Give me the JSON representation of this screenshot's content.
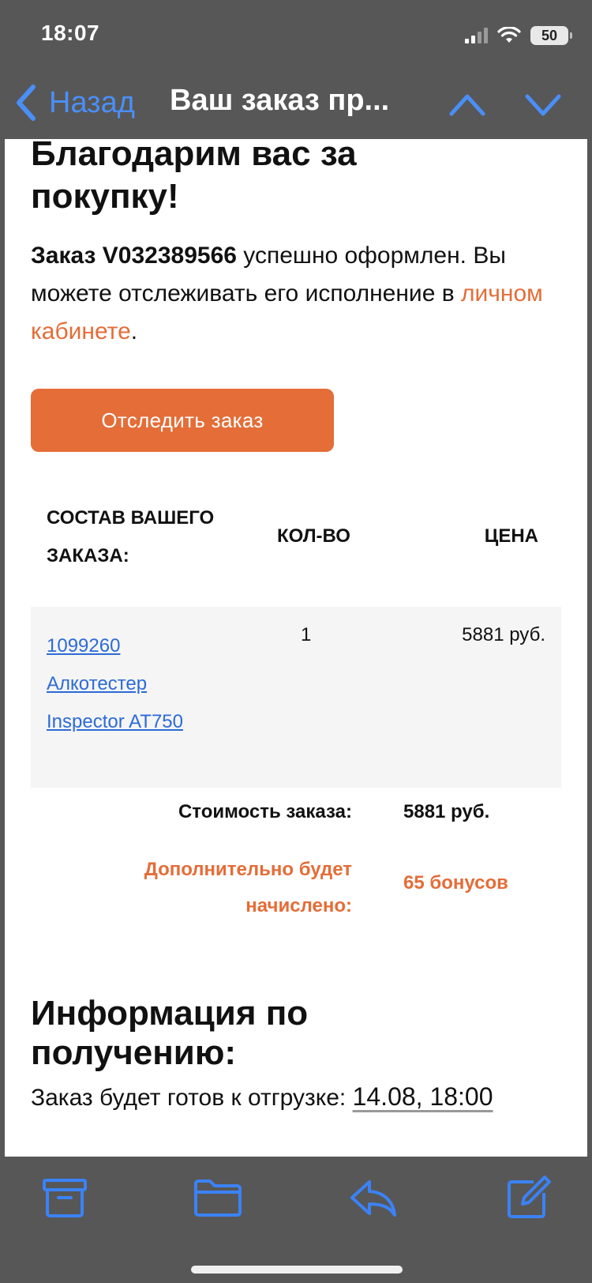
{
  "status": {
    "time": "18:07",
    "battery": "50"
  },
  "nav": {
    "back_label": "Назад",
    "title": "Ваш заказ пр..."
  },
  "email": {
    "thanks_title": "Благодарим вас за покупку!",
    "order_prefix": "Заказ V032389566",
    "order_suffix": " успешно оформлен. Вы можете отслеживать его исполнение в ",
    "cabinet_link": "личном кабинете",
    "order_end": ".",
    "track_button": "Отследить заказ",
    "table": {
      "headers": {
        "items": "СОСТАВ ВАШЕГО ЗАКАЗА:",
        "qty": "КОЛ-ВО",
        "price": "ЦЕНА"
      },
      "rows": [
        {
          "code": "1099260",
          "name_line1": "Алкотестер",
          "name_line2": "Inspector AT750",
          "qty": "1",
          "price": "5881 руб."
        }
      ]
    },
    "total_label": "Стоимость заказа:",
    "total_value": "5881 руб.",
    "bonus_label": "Дополнительно будет начислено:",
    "bonus_value": "65 бонусов",
    "info_title": "Информация по получению:",
    "ready_label": "Заказ будет готов к отгрузке: ",
    "ready_date": "14.08, 18:00"
  },
  "colors": {
    "accent": "#e46d38",
    "link": "#2c6bd6",
    "ios_blue": "#4a8ff7",
    "chrome": "#575757"
  },
  "toolbar": {
    "icons": [
      "archive-icon",
      "folder-icon",
      "reply-icon",
      "compose-icon"
    ]
  }
}
